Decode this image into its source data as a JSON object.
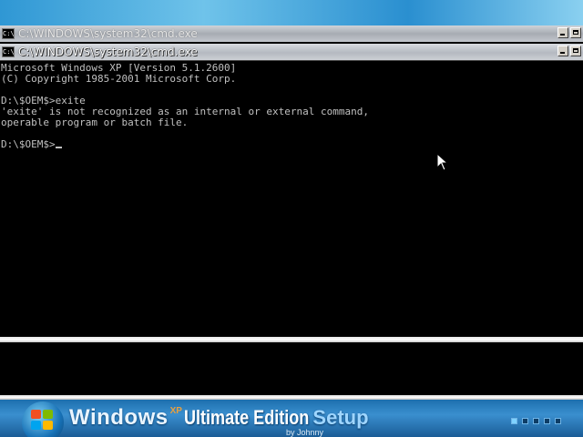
{
  "background_window": {
    "title": "C:\\WINDOWS\\system32\\cmd.exe",
    "icon": "cmd-icon"
  },
  "cmd_window": {
    "title": "C:\\WINDOWS\\system32\\cmd.exe",
    "icon": "cmd-icon",
    "lines": [
      "Microsoft Windows XP [Version 5.1.2600]",
      "(C) Copyright 1985-2001 Microsoft Corp.",
      "",
      "D:\\$OEM$>exite",
      "'exite' is not recognized as an internal or external command,",
      "operable program or batch file.",
      "",
      "D:\\$OEM$>"
    ]
  },
  "setup_banner": {
    "windows": "Windows",
    "xp": "XP",
    "edition": "Ultimate Edition",
    "setup": "Setup",
    "byline": "by Johnny",
    "progress_steps": 5,
    "active_step": 1
  },
  "colors": {
    "console_bg": "#000000",
    "console_text": "#c0c0c0",
    "banner_blue": "#1d6fae"
  }
}
